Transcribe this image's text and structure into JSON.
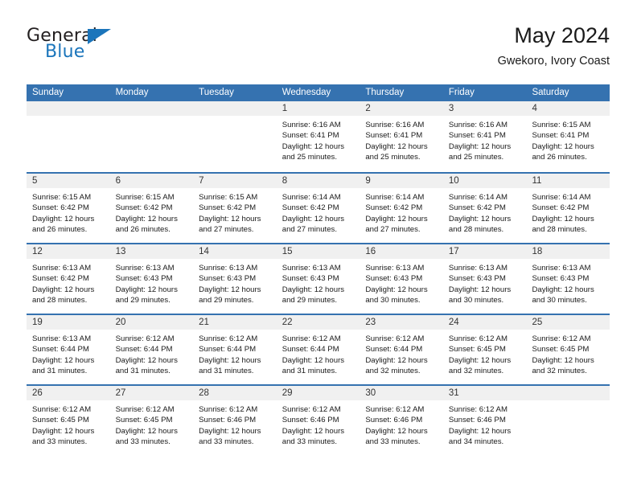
{
  "brand": {
    "name_top": "General",
    "name_bottom": "Blue",
    "color_primary": "#1b75bb",
    "color_text": "#231f20"
  },
  "header": {
    "title": "May 2024",
    "subtitle": "Gwekoro, Ivory Coast"
  },
  "theme": {
    "header_row_bg": "#3572b0",
    "header_row_text": "#ffffff",
    "day_strip_bg": "#f0f0f0",
    "row_divider": "#3572b0",
    "body_text": "#1a1a1a"
  },
  "weekday_headers": [
    "Sunday",
    "Monday",
    "Tuesday",
    "Wednesday",
    "Thursday",
    "Friday",
    "Saturday"
  ],
  "weeks": [
    [
      {
        "day": "",
        "empty": true,
        "lines": []
      },
      {
        "day": "",
        "empty": true,
        "lines": []
      },
      {
        "day": "",
        "empty": true,
        "lines": []
      },
      {
        "day": "1",
        "empty": false,
        "lines": [
          "Sunrise: 6:16 AM",
          "Sunset: 6:41 PM",
          "Daylight: 12 hours",
          "and 25 minutes."
        ]
      },
      {
        "day": "2",
        "empty": false,
        "lines": [
          "Sunrise: 6:16 AM",
          "Sunset: 6:41 PM",
          "Daylight: 12 hours",
          "and 25 minutes."
        ]
      },
      {
        "day": "3",
        "empty": false,
        "lines": [
          "Sunrise: 6:16 AM",
          "Sunset: 6:41 PM",
          "Daylight: 12 hours",
          "and 25 minutes."
        ]
      },
      {
        "day": "4",
        "empty": false,
        "lines": [
          "Sunrise: 6:15 AM",
          "Sunset: 6:41 PM",
          "Daylight: 12 hours",
          "and 26 minutes."
        ]
      }
    ],
    [
      {
        "day": "5",
        "empty": false,
        "lines": [
          "Sunrise: 6:15 AM",
          "Sunset: 6:42 PM",
          "Daylight: 12 hours",
          "and 26 minutes."
        ]
      },
      {
        "day": "6",
        "empty": false,
        "lines": [
          "Sunrise: 6:15 AM",
          "Sunset: 6:42 PM",
          "Daylight: 12 hours",
          "and 26 minutes."
        ]
      },
      {
        "day": "7",
        "empty": false,
        "lines": [
          "Sunrise: 6:15 AM",
          "Sunset: 6:42 PM",
          "Daylight: 12 hours",
          "and 27 minutes."
        ]
      },
      {
        "day": "8",
        "empty": false,
        "lines": [
          "Sunrise: 6:14 AM",
          "Sunset: 6:42 PM",
          "Daylight: 12 hours",
          "and 27 minutes."
        ]
      },
      {
        "day": "9",
        "empty": false,
        "lines": [
          "Sunrise: 6:14 AM",
          "Sunset: 6:42 PM",
          "Daylight: 12 hours",
          "and 27 minutes."
        ]
      },
      {
        "day": "10",
        "empty": false,
        "lines": [
          "Sunrise: 6:14 AM",
          "Sunset: 6:42 PM",
          "Daylight: 12 hours",
          "and 28 minutes."
        ]
      },
      {
        "day": "11",
        "empty": false,
        "lines": [
          "Sunrise: 6:14 AM",
          "Sunset: 6:42 PM",
          "Daylight: 12 hours",
          "and 28 minutes."
        ]
      }
    ],
    [
      {
        "day": "12",
        "empty": false,
        "lines": [
          "Sunrise: 6:13 AM",
          "Sunset: 6:42 PM",
          "Daylight: 12 hours",
          "and 28 minutes."
        ]
      },
      {
        "day": "13",
        "empty": false,
        "lines": [
          "Sunrise: 6:13 AM",
          "Sunset: 6:43 PM",
          "Daylight: 12 hours",
          "and 29 minutes."
        ]
      },
      {
        "day": "14",
        "empty": false,
        "lines": [
          "Sunrise: 6:13 AM",
          "Sunset: 6:43 PM",
          "Daylight: 12 hours",
          "and 29 minutes."
        ]
      },
      {
        "day": "15",
        "empty": false,
        "lines": [
          "Sunrise: 6:13 AM",
          "Sunset: 6:43 PM",
          "Daylight: 12 hours",
          "and 29 minutes."
        ]
      },
      {
        "day": "16",
        "empty": false,
        "lines": [
          "Sunrise: 6:13 AM",
          "Sunset: 6:43 PM",
          "Daylight: 12 hours",
          "and 30 minutes."
        ]
      },
      {
        "day": "17",
        "empty": false,
        "lines": [
          "Sunrise: 6:13 AM",
          "Sunset: 6:43 PM",
          "Daylight: 12 hours",
          "and 30 minutes."
        ]
      },
      {
        "day": "18",
        "empty": false,
        "lines": [
          "Sunrise: 6:13 AM",
          "Sunset: 6:43 PM",
          "Daylight: 12 hours",
          "and 30 minutes."
        ]
      }
    ],
    [
      {
        "day": "19",
        "empty": false,
        "lines": [
          "Sunrise: 6:13 AM",
          "Sunset: 6:44 PM",
          "Daylight: 12 hours",
          "and 31 minutes."
        ]
      },
      {
        "day": "20",
        "empty": false,
        "lines": [
          "Sunrise: 6:12 AM",
          "Sunset: 6:44 PM",
          "Daylight: 12 hours",
          "and 31 minutes."
        ]
      },
      {
        "day": "21",
        "empty": false,
        "lines": [
          "Sunrise: 6:12 AM",
          "Sunset: 6:44 PM",
          "Daylight: 12 hours",
          "and 31 minutes."
        ]
      },
      {
        "day": "22",
        "empty": false,
        "lines": [
          "Sunrise: 6:12 AM",
          "Sunset: 6:44 PM",
          "Daylight: 12 hours",
          "and 31 minutes."
        ]
      },
      {
        "day": "23",
        "empty": false,
        "lines": [
          "Sunrise: 6:12 AM",
          "Sunset: 6:44 PM",
          "Daylight: 12 hours",
          "and 32 minutes."
        ]
      },
      {
        "day": "24",
        "empty": false,
        "lines": [
          "Sunrise: 6:12 AM",
          "Sunset: 6:45 PM",
          "Daylight: 12 hours",
          "and 32 minutes."
        ]
      },
      {
        "day": "25",
        "empty": false,
        "lines": [
          "Sunrise: 6:12 AM",
          "Sunset: 6:45 PM",
          "Daylight: 12 hours",
          "and 32 minutes."
        ]
      }
    ],
    [
      {
        "day": "26",
        "empty": false,
        "lines": [
          "Sunrise: 6:12 AM",
          "Sunset: 6:45 PM",
          "Daylight: 12 hours",
          "and 33 minutes."
        ]
      },
      {
        "day": "27",
        "empty": false,
        "lines": [
          "Sunrise: 6:12 AM",
          "Sunset: 6:45 PM",
          "Daylight: 12 hours",
          "and 33 minutes."
        ]
      },
      {
        "day": "28",
        "empty": false,
        "lines": [
          "Sunrise: 6:12 AM",
          "Sunset: 6:46 PM",
          "Daylight: 12 hours",
          "and 33 minutes."
        ]
      },
      {
        "day": "29",
        "empty": false,
        "lines": [
          "Sunrise: 6:12 AM",
          "Sunset: 6:46 PM",
          "Daylight: 12 hours",
          "and 33 minutes."
        ]
      },
      {
        "day": "30",
        "empty": false,
        "lines": [
          "Sunrise: 6:12 AM",
          "Sunset: 6:46 PM",
          "Daylight: 12 hours",
          "and 33 minutes."
        ]
      },
      {
        "day": "31",
        "empty": false,
        "lines": [
          "Sunrise: 6:12 AM",
          "Sunset: 6:46 PM",
          "Daylight: 12 hours",
          "and 34 minutes."
        ]
      },
      {
        "day": "",
        "empty": true,
        "lines": []
      }
    ]
  ]
}
